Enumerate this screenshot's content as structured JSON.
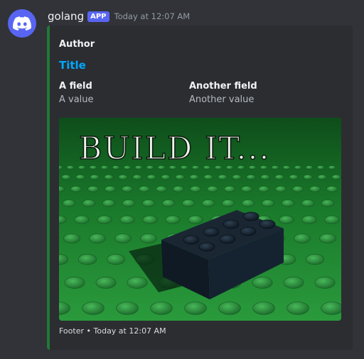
{
  "message": {
    "username": "golang",
    "badge": "APP",
    "timestamp": "Today at 12:07 AM",
    "avatar_icon": "discord-logo-icon"
  },
  "embed": {
    "accent_color": "#1f7a36",
    "author": "Author",
    "title": "Title",
    "fields": [
      {
        "name": "A field",
        "value": "A value"
      },
      {
        "name": "Another field",
        "value": "Another value"
      }
    ],
    "image": {
      "caption": "BUILD IT..."
    },
    "footer": {
      "text": "Footer",
      "separator": "•",
      "timestamp": "Today at 12:07 AM"
    }
  }
}
